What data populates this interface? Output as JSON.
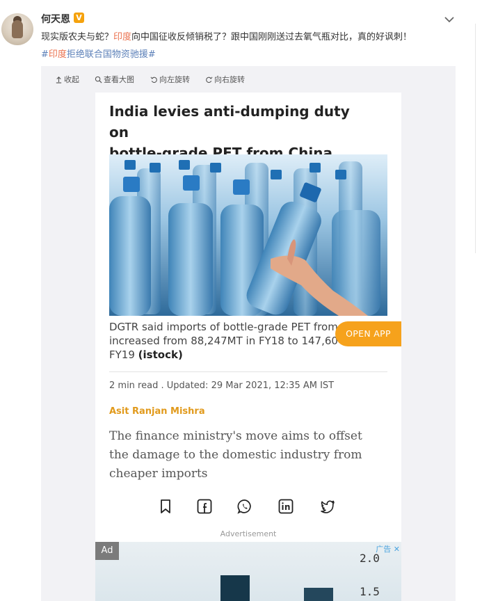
{
  "post": {
    "username": "何天恩",
    "badge": "V",
    "text_a": "现实版农夫与蛇？",
    "text_kw": "印度",
    "text_b": "向中国征收反倾销税了？跟中国刚刚送过去氧气瓶对比，真的好讽刺！",
    "tag_hash": "#",
    "tag_kw": "印度",
    "tag_rest": "拒绝联合国物资驰援#"
  },
  "toolbar": {
    "collapse": "收起",
    "view_large": "查看大图",
    "rotate_left": "向左旋转",
    "rotate_right": "向右旋转"
  },
  "article": {
    "headline_1": "India levies anti-dumping duty on",
    "headline_2": "bottle-grade PET from China",
    "caption_1": "DGTR said imports of bottle-grade PET from",
    "caption_2": "increased from 88,247MT in FY18 to 147,60",
    "caption_3": "FY19",
    "caption_credit": "(istock)",
    "open_app": "OPEN APP",
    "meta": "2 min read . Updated: 29 Mar 2021, 12:35 AM IST",
    "author": "Asit Ranjan Mishra",
    "summary_1": "The finance ministry's move aims to offset",
    "summary_2": "the damage to the domestic industry from",
    "summary_3": "cheaper imports",
    "advertisement": "Advertisement"
  },
  "ad": {
    "tag": "Ad",
    "corner": "广告 ✕",
    "tick_top": "2.0",
    "tick_bottom": "1.5"
  },
  "icons": [
    "chevron-down-icon",
    "collapse-icon",
    "magnify-icon",
    "rotate-left-icon",
    "rotate-right-icon",
    "bookmark-icon",
    "facebook-icon",
    "whatsapp-icon",
    "linkedin-icon",
    "twitter-icon"
  ],
  "colors": {
    "keyword": "#eb7350",
    "topic": "#5d81b9",
    "open_app": "#f6a21c",
    "author": "#e19a1c",
    "badge": "#f5a20d"
  }
}
